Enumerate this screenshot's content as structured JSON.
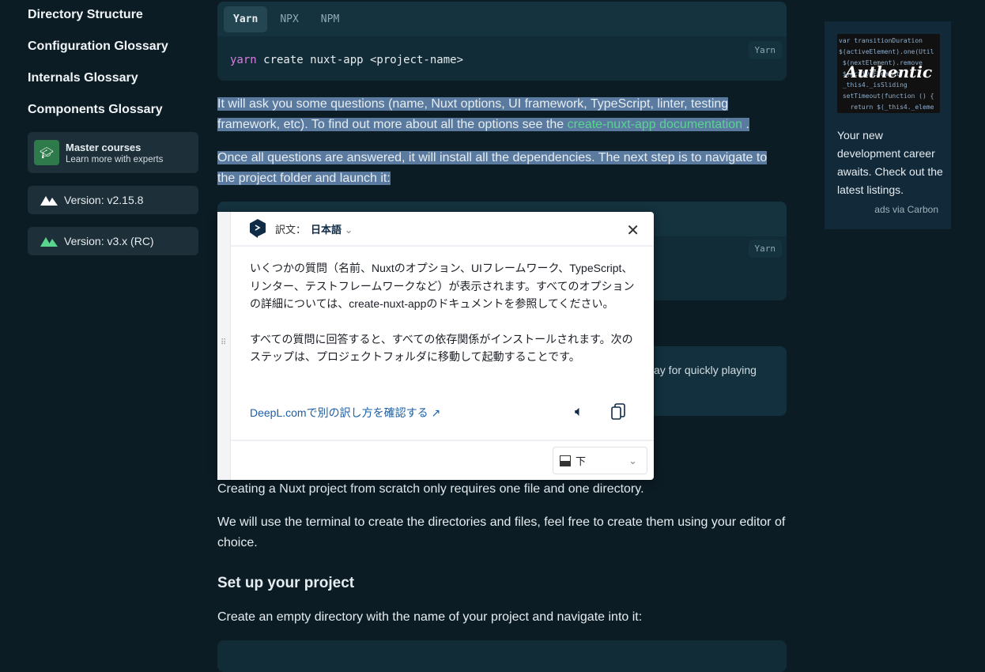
{
  "sidebar": {
    "items": [
      "Directory Structure",
      "Configuration Glossary",
      "Internals Glossary",
      "Components Glossary"
    ],
    "courses": {
      "title": "Master courses",
      "subtitle": "Learn more with experts"
    },
    "versions": [
      "Version: v2.15.8",
      "Version: v3.x (RC)"
    ]
  },
  "code1": {
    "tabs": [
      "Yarn",
      "NPX",
      "NPM"
    ],
    "cmd": "yarn",
    "rest": " create nuxt-app <project-name>",
    "lang": "Yarn"
  },
  "code2": {
    "lang": "Yarn"
  },
  "para1": {
    "text": "It will ask you some questions (name, Nuxt options, UI framework, TypeScript, linter, testing framework, etc). To find out more about all the options see the ",
    "link": "create-nuxt-app documentation",
    "end": " ."
  },
  "para2": "Once all questions are answered, it will install all the dependencies. The next step is to navigate to the project folder and launch it:",
  "info_partial": "ay for quickly playing",
  "para3": "Creating a Nuxt project from scratch only requires one file and one directory.",
  "para4": "We will use the terminal to create the directories and files, feel free to create them using your editor of choice.",
  "heading": "Set up your project",
  "para5": "Create an empty directory with the name of your project and navigate into it:",
  "ad": {
    "image_text": "Authentic",
    "text": "Your new development career awaits. Check out the latest listings.",
    "via": "ads via Carbon"
  },
  "deepl": {
    "label": "訳文：",
    "lang": "日本語",
    "p1": "いくつかの質問（名前、Nuxtのオプション、UIフレームワーク、TypeScript、リンター、テストフレームワークなど）が表示されます。すべてのオプションの詳細については、create-nuxt-appのドキュメントを参照してください。",
    "p2": "すべての質問に回答すると、すべての依存関係がインストールされます。次のステップは、プロジェクトフォルダに移動して起動することです。",
    "link": "DeepL.comで別の訳し方を確認する",
    "position": "下"
  },
  "colors": {
    "accent": "#58d58f",
    "selection": "#5a7aa0",
    "background": "#0c1c25",
    "deepl_link": "#1a5fa8"
  }
}
